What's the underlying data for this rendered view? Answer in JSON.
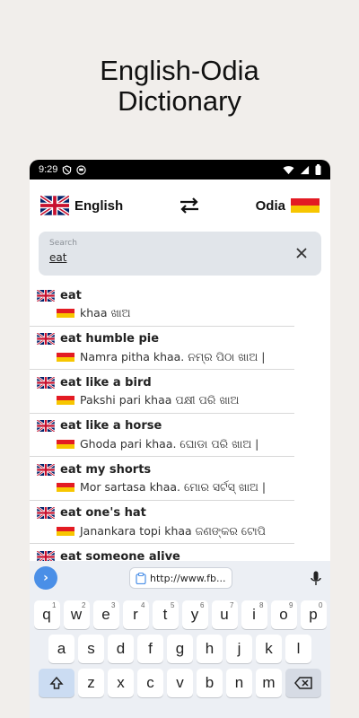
{
  "promo": {
    "line1": "English-Odia",
    "line2": "Dictionary"
  },
  "status": {
    "time": "9:29"
  },
  "langbar": {
    "source": "English",
    "target": "Odia"
  },
  "search": {
    "label": "Search",
    "value": "eat"
  },
  "results": [
    {
      "en": "eat",
      "od": "khaa  ଖାଅ"
    },
    {
      "en": "eat humble pie",
      "od": "Namra pitha khaa.  ନମ୍ର ପିଠା ଖାଅ |"
    },
    {
      "en": "eat like a bird",
      "od": "Pakshi pari khaa  ପକ୍ଷୀ ପରି ଖାଅ"
    },
    {
      "en": "eat like a horse",
      "od": "Ghoda pari khaa.  ଘୋଡା ପରି ଖାଅ |"
    },
    {
      "en": "eat my shorts",
      "od": "Mor sartasa khaa.  ମୋର ସର୍ଟସ୍ ଖାଅ |"
    },
    {
      "en": "eat one's hat",
      "od": "Janankara topi khaa  ଜଣଙ୍କର ଟୋପି"
    },
    {
      "en": "eat someone alive",
      "od": ""
    }
  ],
  "keyboard": {
    "url_chip": "http://www.fb...",
    "row1": [
      {
        "k": "q",
        "s": "1"
      },
      {
        "k": "w",
        "s": "2"
      },
      {
        "k": "e",
        "s": "3"
      },
      {
        "k": "r",
        "s": "4"
      },
      {
        "k": "t",
        "s": "5"
      },
      {
        "k": "y",
        "s": "6"
      },
      {
        "k": "u",
        "s": "7"
      },
      {
        "k": "i",
        "s": "8"
      },
      {
        "k": "o",
        "s": "9"
      },
      {
        "k": "p",
        "s": "0"
      }
    ],
    "row2": [
      "a",
      "s",
      "d",
      "f",
      "g",
      "h",
      "j",
      "k",
      "l"
    ],
    "row3": [
      "z",
      "x",
      "c",
      "v",
      "b",
      "n",
      "m"
    ]
  },
  "colors": {
    "accent": "#4a8fe7",
    "search_bg": "#e1e5ea",
    "odia_red": "#e31b23",
    "odia_yellow": "#f7c600"
  }
}
